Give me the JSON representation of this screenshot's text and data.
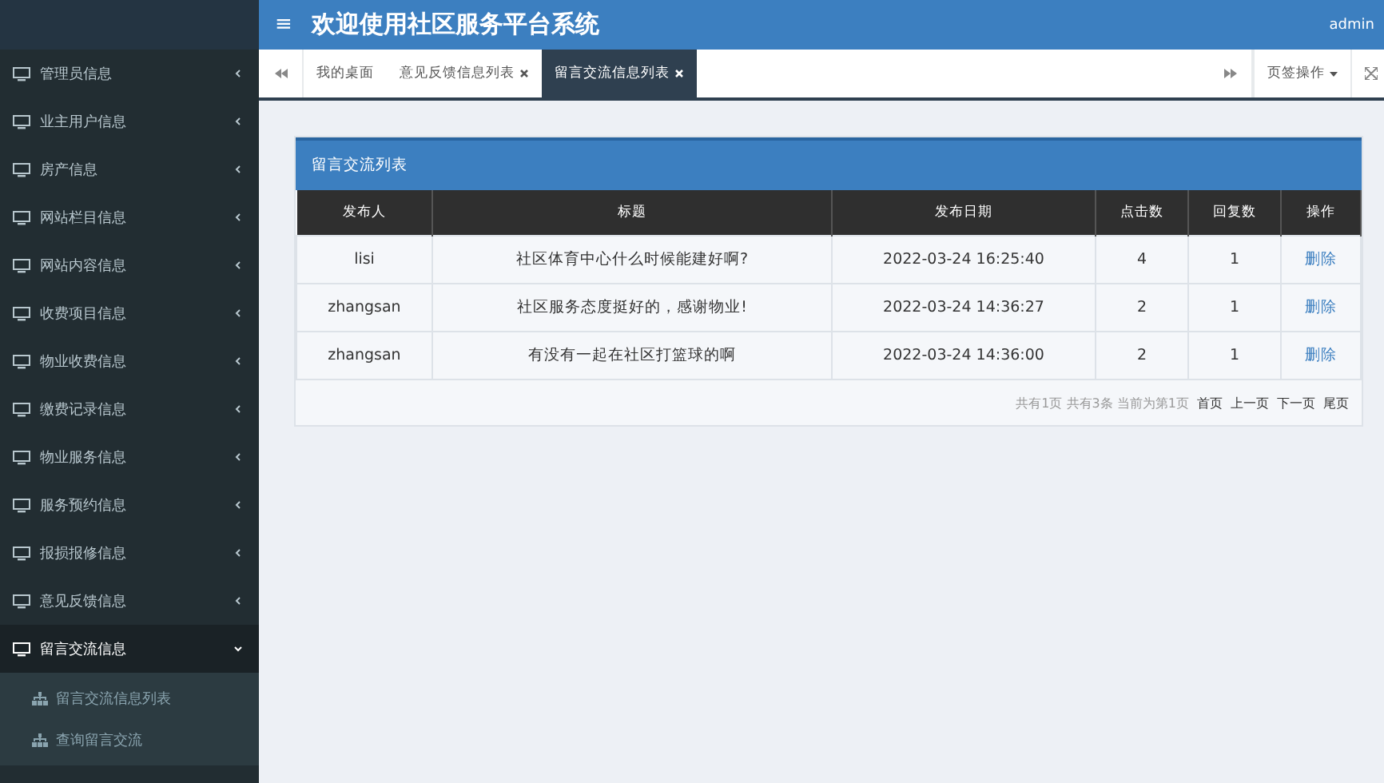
{
  "header": {
    "menu_glyph": "≡",
    "title": "欢迎使用社区服务平台系统",
    "user": "admin"
  },
  "sidebar": {
    "items": [
      {
        "label": "管理员信息",
        "expanded": false
      },
      {
        "label": "业主用户信息",
        "expanded": false
      },
      {
        "label": "房产信息",
        "expanded": false
      },
      {
        "label": "网站栏目信息",
        "expanded": false
      },
      {
        "label": "网站内容信息",
        "expanded": false
      },
      {
        "label": "收费项目信息",
        "expanded": false
      },
      {
        "label": "物业收费信息",
        "expanded": false
      },
      {
        "label": "缴费记录信息",
        "expanded": false
      },
      {
        "label": "物业服务信息",
        "expanded": false
      },
      {
        "label": "服务预约信息",
        "expanded": false
      },
      {
        "label": "报损报修信息",
        "expanded": false
      },
      {
        "label": "意见反馈信息",
        "expanded": false
      },
      {
        "label": "留言交流信息",
        "expanded": true,
        "children": [
          {
            "label": "留言交流信息列表"
          },
          {
            "label": "查询留言交流"
          }
        ]
      }
    ]
  },
  "tabs": [
    {
      "label": "我的桌面",
      "closable": false,
      "selected": false
    },
    {
      "label": "意见反馈信息列表",
      "closable": true,
      "selected": false
    },
    {
      "label": "留言交流信息列表",
      "closable": true,
      "selected": true
    }
  ],
  "tab_actions": {
    "label": "页签操作"
  },
  "panel": {
    "title": "留言交流列表",
    "columns": [
      "发布人",
      "标题",
      "发布日期",
      "点击数",
      "回复数",
      "操作"
    ],
    "rows": [
      {
        "author": "lisi",
        "title": "社区体育中心什么时候能建好啊?",
        "date": "2022-03-24 16:25:40",
        "clicks": "4",
        "replies": "1",
        "action": "删除"
      },
      {
        "author": "zhangsan",
        "title": "社区服务态度挺好的，感谢物业!",
        "date": "2022-03-24 14:36:27",
        "clicks": "2",
        "replies": "1",
        "action": "删除"
      },
      {
        "author": "zhangsan",
        "title": "有没有一起在社区打篮球的啊",
        "date": "2022-03-24 14:36:00",
        "clicks": "2",
        "replies": "1",
        "action": "删除"
      }
    ],
    "pagination": {
      "summary": "共有1页 共有3条 当前为第1页",
      "links": [
        "首页",
        "上一页",
        "下一页",
        "尾页"
      ]
    }
  }
}
